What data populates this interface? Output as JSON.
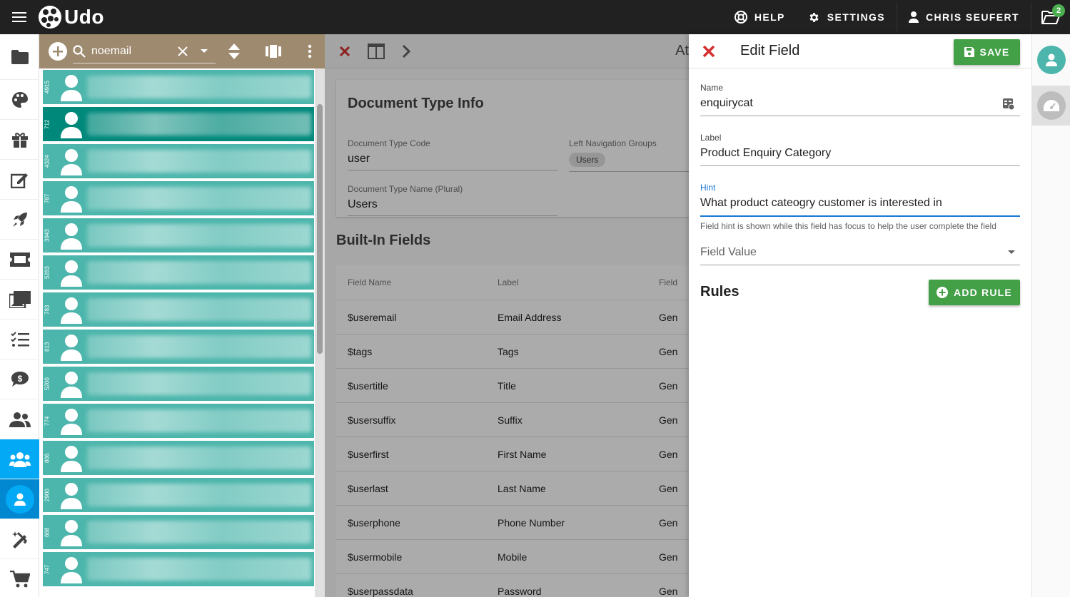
{
  "app": {
    "name": "Udo"
  },
  "topbar": {
    "help_label": "HELP",
    "settings_label": "SETTINGS",
    "user_label": "CHRIS SEUFERT",
    "folder_badge": "2"
  },
  "search": {
    "value": "noemail"
  },
  "list": {
    "ids": [
      "4915",
      "712",
      "4324",
      "787",
      "3943",
      "5283",
      "783",
      "813",
      "5200",
      "774",
      "806",
      "2900",
      "668",
      "747"
    ]
  },
  "middle": {
    "title_stub": "At",
    "doc_info_title": "Document Type Info",
    "code_label": "Document Type Code",
    "code_value": "user",
    "nav_label": "Left Navigation Groups",
    "nav_chip": "Users",
    "plural_label": "Document Type Name (Plural)",
    "plural_value": "Users",
    "builtin_title": "Built-In Fields",
    "columns": [
      "Field Name",
      "Label",
      "Field"
    ],
    "rows": [
      [
        "$useremail",
        "Email Address",
        "Gen"
      ],
      [
        "$tags",
        "Tags",
        "Gen"
      ],
      [
        "$usertitle",
        "Title",
        "Gen"
      ],
      [
        "$usersuffix",
        "Suffix",
        "Gen"
      ],
      [
        "$userfirst",
        "First Name",
        "Gen"
      ],
      [
        "$userlast",
        "Last Name",
        "Gen"
      ],
      [
        "$userphone",
        "Phone Number",
        "Gen"
      ],
      [
        "$usermobile",
        "Mobile",
        "Gen"
      ],
      [
        "$userpassdata",
        "Password",
        "Gen"
      ]
    ]
  },
  "edit": {
    "title": "Edit Field",
    "save_label": "SAVE",
    "name_label": "Name",
    "name_value": "enquirycat",
    "label_label": "Label",
    "label_value": "Product Enquiry Category",
    "hint_label": "Hint",
    "hint_value": "What product cateogry customer is interested in",
    "hint_help": "Field hint is shown while this field has focus to help the user complete the field",
    "field_value_label": "Field Value",
    "rules_title": "Rules",
    "add_rule_label": "ADD RULE"
  },
  "colors": {
    "accent": "#03a9f4",
    "green": "#43a047",
    "teal": "#4db6ac",
    "teal_dark": "#00897b",
    "close_red": "#d32f2f"
  }
}
